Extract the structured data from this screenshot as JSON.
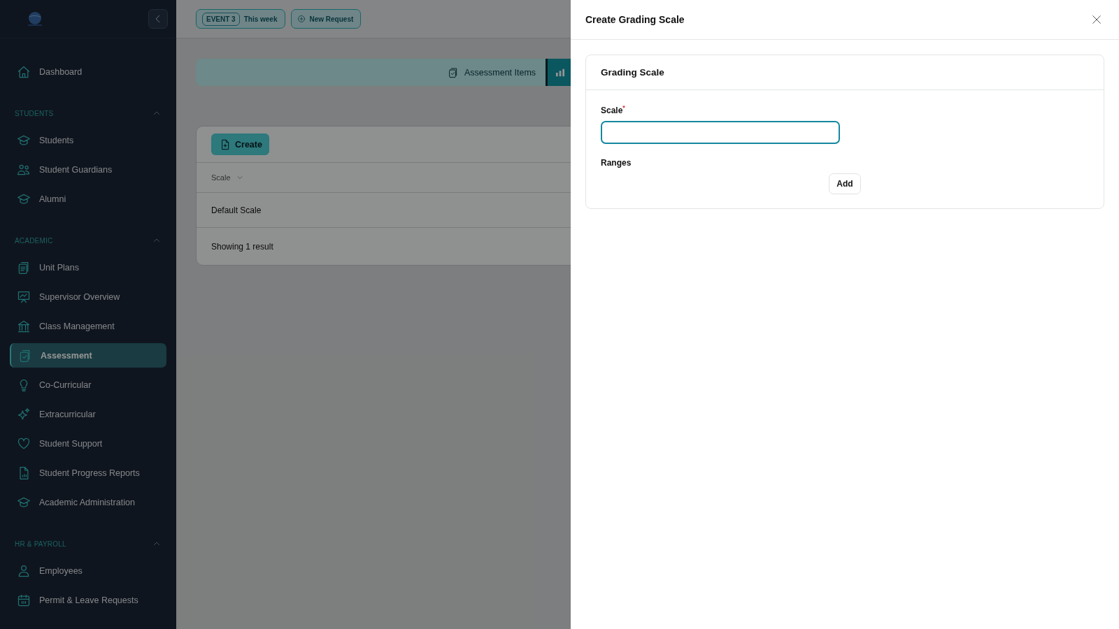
{
  "sidebar": {
    "sections": [
      {
        "items": [
          {
            "label": "Dashboard",
            "selected": false
          }
        ]
      },
      {
        "title": "STUDENTS",
        "expanded": true,
        "items": [
          {
            "label": "Students",
            "selected": false
          },
          {
            "label": "Student Guardians",
            "selected": false
          },
          {
            "label": "Alumni",
            "selected": false
          }
        ]
      },
      {
        "title": "ACADEMIC",
        "expanded": true,
        "items": [
          {
            "label": "Unit Plans",
            "selected": false
          },
          {
            "label": "Supervisor Overview",
            "selected": false
          },
          {
            "label": "Class Management",
            "selected": false
          },
          {
            "label": "Assessment",
            "selected": true
          },
          {
            "label": "Co-Curricular",
            "selected": false
          },
          {
            "label": "Extracurricular",
            "selected": false
          },
          {
            "label": "Student Support",
            "selected": false
          },
          {
            "label": "Student Progress Reports",
            "selected": false
          },
          {
            "label": "Academic Administration",
            "selected": false
          }
        ]
      },
      {
        "title": "HR & PAYROLL",
        "expanded": true,
        "items": [
          {
            "label": "Employees",
            "selected": false
          },
          {
            "label": "Permit & Leave Requests",
            "selected": false
          }
        ]
      }
    ]
  },
  "topbar": {
    "event_badge": "EVENT 3",
    "event_label": "This week",
    "new_request": "New Request"
  },
  "tabs": [
    {
      "label": "Assessment Items",
      "selected": false
    },
    {
      "selected": true
    }
  ],
  "create_button": "Create",
  "table": {
    "columns": [
      {
        "label": "Scale"
      }
    ],
    "rows": [
      [
        "Default Scale"
      ]
    ],
    "footer": "Showing 1 result"
  },
  "drawer": {
    "title": "Create Grading Scale",
    "card": {
      "title": "Grading Scale",
      "fields": [
        {
          "label": "Scale$^{*}$",
          "focused": true
        }
      ],
      "ranges_label": "Ranges",
      "add_button": "Add"
    }
  }
}
